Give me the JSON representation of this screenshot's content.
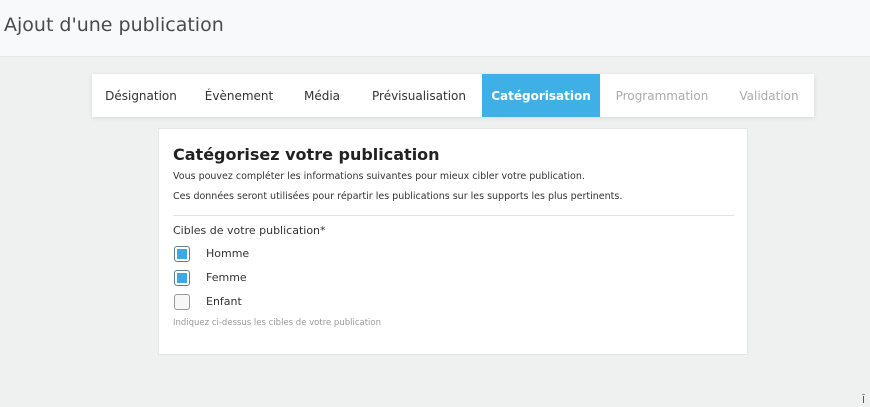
{
  "header": {
    "title": "Ajout d'une publication"
  },
  "wizard": {
    "tabs": [
      {
        "label": "Désignation",
        "state": "normal"
      },
      {
        "label": "Évènement",
        "state": "normal"
      },
      {
        "label": "Média",
        "state": "normal"
      },
      {
        "label": "Prévisualisation",
        "state": "normal"
      },
      {
        "label": "Catégorisation",
        "state": "active"
      },
      {
        "label": "Programmation",
        "state": "disabled"
      },
      {
        "label": "Validation",
        "state": "disabled"
      }
    ]
  },
  "card": {
    "title": "Catégorisez votre publication",
    "desc1": "Vous pouvez compléter les informations suivantes pour mieux cibler votre publication.",
    "desc2": "Ces données seront utilisées pour répartir les publications sur les supports les plus pertinents.",
    "targets_label": "Cibles de votre publication*",
    "options": [
      {
        "label": "Homme",
        "checked": true
      },
      {
        "label": "Femme",
        "checked": true
      },
      {
        "label": "Enfant",
        "checked": false
      }
    ],
    "help": "Indiquez ci-dessus les cibles de votre publication"
  },
  "colors": {
    "accent": "#3fb0e6",
    "page_bg": "#eff1f1"
  },
  "corner_icon": "text-cursor-icon"
}
